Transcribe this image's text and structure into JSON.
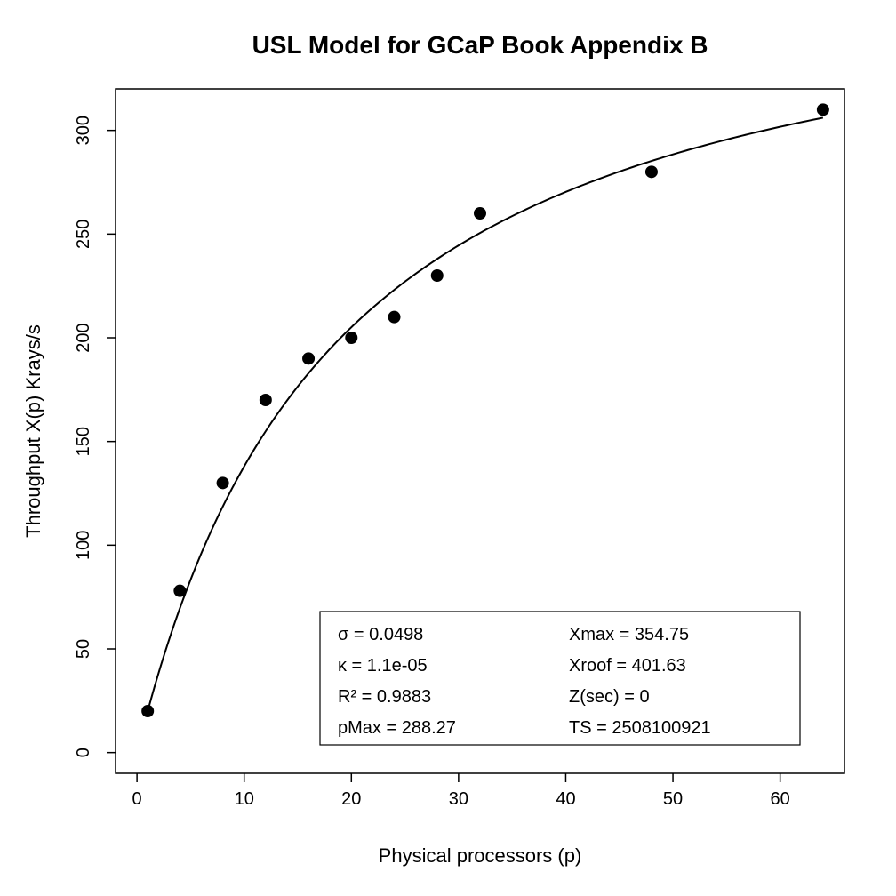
{
  "chart_data": {
    "type": "scatter",
    "title": "USL Model for GCaP Book Appendix B",
    "xlabel": "Physical processors (p)",
    "ylabel": "Throughput X(p) Krays/s",
    "xlim": [
      -2,
      66
    ],
    "ylim": [
      -10,
      320
    ],
    "x_ticks": [
      0,
      10,
      20,
      30,
      40,
      50,
      60
    ],
    "y_ticks": [
      0,
      50,
      100,
      150,
      200,
      250,
      300
    ],
    "series": [
      {
        "name": "data-points",
        "type": "points",
        "x": [
          1,
          4,
          8,
          12,
          16,
          20,
          24,
          28,
          32,
          48,
          64
        ],
        "values": [
          20,
          78,
          130,
          170,
          190,
          200,
          210,
          230,
          260,
          280,
          310
        ]
      },
      {
        "name": "usl-fit-curve",
        "type": "line",
        "model": "X(p) = p*X1 / (1 + sigma*(p-1) + kappa*p*(p-1))",
        "params": {
          "X1": 20,
          "sigma": 0.0498,
          "kappa": 1.1e-05
        },
        "x_range": [
          1,
          64
        ]
      }
    ],
    "legend": {
      "sigma": "σ = 0.0498",
      "kappa": "κ = 1.1e-05",
      "r2": "R² = 0.9883",
      "pmax": "pMax = 288.27",
      "xmax": "Xmax = 354.75",
      "xroof": "Xroof = 401.63",
      "zsec": "Z(sec) = 0",
      "ts": "TS = 2508100921"
    }
  }
}
